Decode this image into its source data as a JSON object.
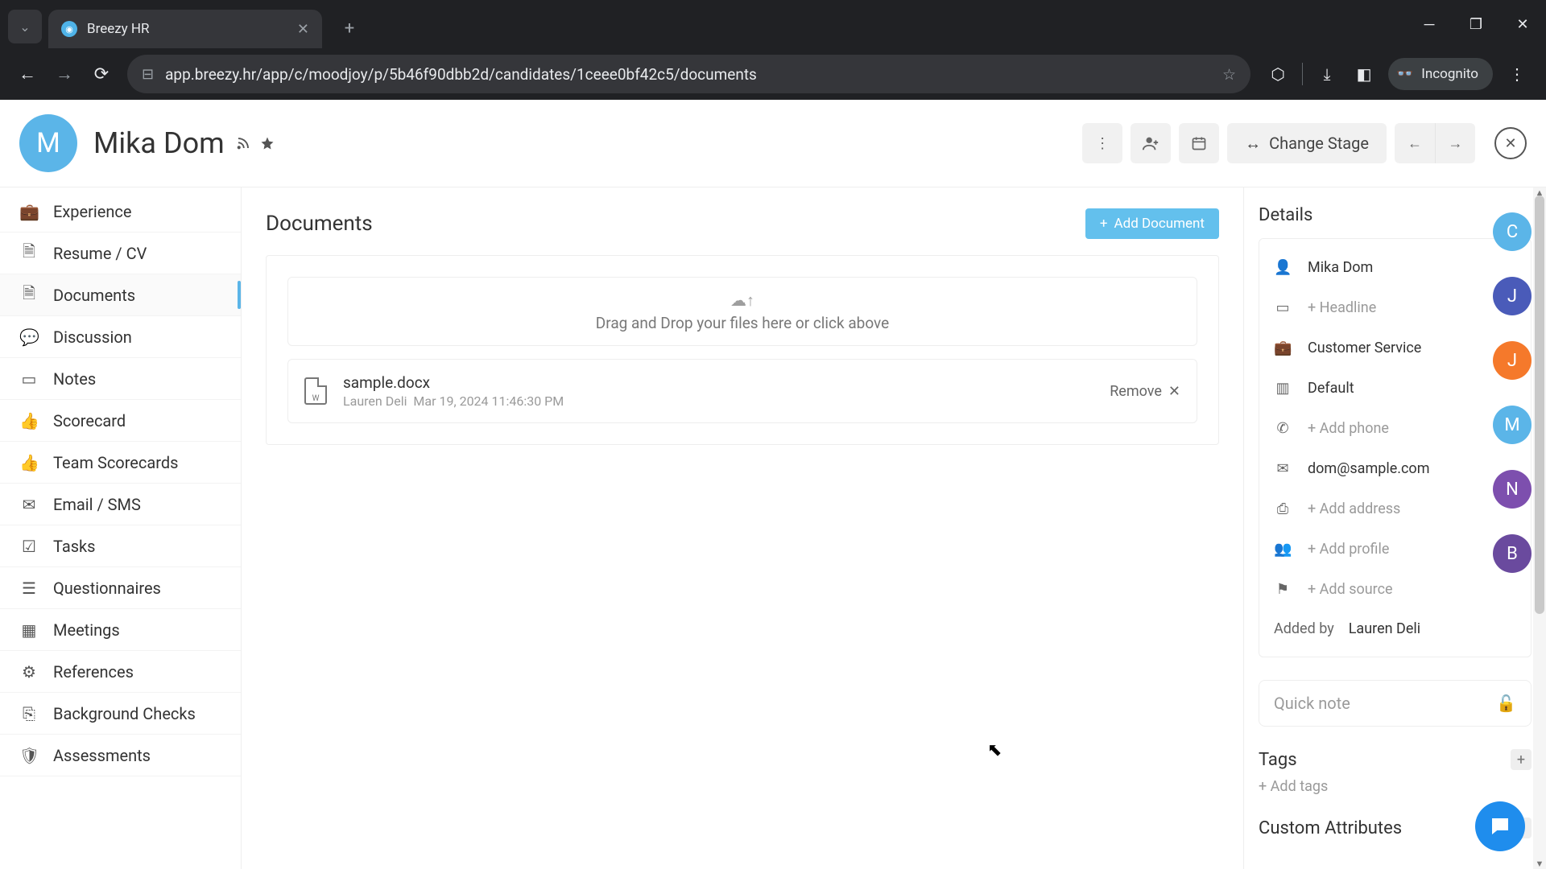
{
  "browser": {
    "tab_title": "Breezy HR",
    "url": "app.breezy.hr/app/c/moodjoy/p/5b46f90dbb2d/candidates/1ceee0bf42c5/documents",
    "incognito_label": "Incognito"
  },
  "header": {
    "avatar_initial": "M",
    "candidate_name": "Mika Dom",
    "change_stage_label": "Change Stage"
  },
  "sidebar": {
    "items": [
      {
        "label": "Experience",
        "icon": "briefcase"
      },
      {
        "label": "Resume / CV",
        "icon": "file"
      },
      {
        "label": "Documents",
        "icon": "file",
        "active": true
      },
      {
        "label": "Discussion",
        "icon": "chat"
      },
      {
        "label": "Notes",
        "icon": "note"
      },
      {
        "label": "Scorecard",
        "icon": "thumbs-up"
      },
      {
        "label": "Team Scorecards",
        "icon": "thumbs-up"
      },
      {
        "label": "Email / SMS",
        "icon": "mail"
      },
      {
        "label": "Tasks",
        "icon": "check"
      },
      {
        "label": "Questionnaires",
        "icon": "list"
      },
      {
        "label": "Meetings",
        "icon": "calendar"
      },
      {
        "label": "References",
        "icon": "gear"
      },
      {
        "label": "Background Checks",
        "icon": "id-card"
      },
      {
        "label": "Assessments",
        "icon": "shield"
      }
    ]
  },
  "main": {
    "title": "Documents",
    "add_button": "Add Document",
    "dropzone_hint": "Drag and Drop your files here or click above",
    "documents": [
      {
        "name": "sample.docx",
        "uploader": "Lauren Deli",
        "uploaded_at": "Mar 19, 2024 11:46:30 PM",
        "remove_label": "Remove"
      }
    ]
  },
  "details": {
    "title": "Details",
    "name": "Mika Dom",
    "headline_ph": "+ Headline",
    "position": "Customer Service",
    "pipeline": "Default",
    "phone_ph": "+ Add phone",
    "email": "dom@sample.com",
    "address_ph": "+ Add address",
    "profile_ph": "+ Add profile",
    "source_ph": "+ Add source",
    "added_by_label": "Added by",
    "added_by_value": "Lauren Deli",
    "quick_note_ph": "Quick note",
    "tags_title": "Tags",
    "add_tags_ph": "+ Add tags",
    "custom_attrs_title": "Custom Attributes"
  },
  "rail": [
    {
      "initial": "C",
      "color": "#5bb5e8"
    },
    {
      "initial": "J",
      "color": "#4a5bb9"
    },
    {
      "initial": "J",
      "color": "#f5792b"
    },
    {
      "initial": "M",
      "color": "#5bb5e8"
    },
    {
      "initial": "N",
      "color": "#7d4fae"
    },
    {
      "initial": "B",
      "color": "#6a4a9e"
    }
  ]
}
